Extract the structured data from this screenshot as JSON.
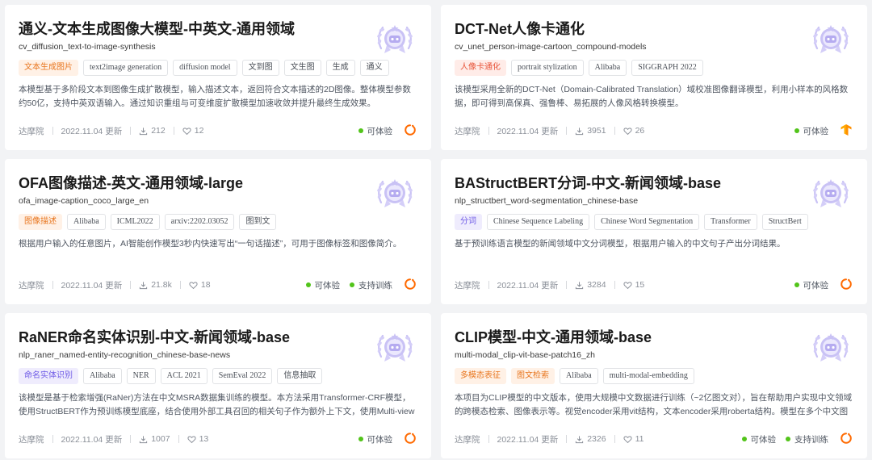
{
  "cards": [
    {
      "title": "通义-文本生成图像大模型-中英文-通用领域",
      "model_id": "cv_diffusion_text-to-image-synthesis",
      "category": "文本生成图片",
      "category_color": "orange",
      "tags": [
        "text2image generation",
        "diffusion model",
        "文到图",
        "文生图",
        "生成",
        "通义"
      ],
      "description": "本模型基于多阶段文本到图像生成扩散模型，输入描述文本，返回符合文本描述的2D图像。整体模型参数约50亿，支持中英双语输入。通过知识重组与可变维度扩散模型加速收敛并提升最终生成效果。",
      "org": "达摩院",
      "updated": "2022.11.04 更新",
      "downloads": "212",
      "likes": "12",
      "statuses": [
        "可体验"
      ],
      "provider_icon": "modelscope-icon"
    },
    {
      "title": "DCT-Net人像卡通化",
      "model_id": "cv_unet_person-image-cartoon_compound-models",
      "category": "人像卡通化",
      "category_color": "red",
      "tags": [
        "portrait stylization",
        "Alibaba",
        "SIGGRAPH 2022"
      ],
      "description": "该模型采用全新的DCT-Net（Domain-Calibrated Translation）域校准图像翻译模型，利用小样本的风格数据，即可得到高保真、强鲁棒、易拓展的人像风格转换模型。",
      "org": "达摩院",
      "updated": "2022.11.04 更新",
      "downloads": "3951",
      "likes": "26",
      "statuses": [
        "可体验"
      ],
      "provider_icon": "tensorflow-icon"
    },
    {
      "title": "OFA图像描述-英文-通用领域-large",
      "model_id": "ofa_image-caption_coco_large_en",
      "category": "图像描述",
      "category_color": "orange",
      "tags": [
        "Alibaba",
        "ICML2022",
        "arxiv:2202.03052",
        "图到文"
      ],
      "description": "根据用户输入的任意图片，AI智能创作模型3秒内快速写出“一句话描述”，可用于图像标签和图像简介。",
      "org": "达摩院",
      "updated": "2022.11.04 更新",
      "downloads": "21.8k",
      "likes": "18",
      "statuses": [
        "可体验",
        "支持训练"
      ],
      "provider_icon": "modelscope-icon"
    },
    {
      "title": "BAStructBERT分词-中文-新闻领域-base",
      "model_id": "nlp_structbert_word-segmentation_chinese-base",
      "category": "分词",
      "category_color": "purple",
      "tags": [
        "Chinese Sequence Labeling",
        "Chinese Word Segmentation",
        "Transformer",
        "StructBert"
      ],
      "description": "基于预训练语言模型的新闻领域中文分词模型，根据用户输入的中文句子产出分词结果。",
      "org": "达摩院",
      "updated": "2022.11.04 更新",
      "downloads": "3284",
      "likes": "15",
      "statuses": [
        "可体验"
      ],
      "provider_icon": "modelscope-icon"
    },
    {
      "title": "RaNER命名实体识别-中文-新闻领域-base",
      "model_id": "nlp_raner_named-entity-recognition_chinese-base-news",
      "category": "命名实体识别",
      "category_color": "purple",
      "tags": [
        "Alibaba",
        "NER",
        "ACL 2021",
        "SemEval 2022",
        "信息抽取"
      ],
      "description": "该模型是基于检索增强(RaNer)方法在中文MSRA数据集训练的模型。本方法采用Transformer-CRF模型，使用StructBERT作为预训练模型底座，结合使用外部工具召回的相关句子作为额外上下文，使用Multi-view Trainin...",
      "org": "达摩院",
      "updated": "2022.11.04 更新",
      "downloads": "1007",
      "likes": "13",
      "statuses": [
        "可体验"
      ],
      "provider_icon": "modelscope-icon"
    },
    {
      "title": "CLIP模型-中文-通用领域-base",
      "model_id": "multi-modal_clip-vit-base-patch16_zh",
      "category": "多模态表征",
      "category_color": "orange",
      "category2": "图文检索",
      "tags": [
        "Alibaba",
        "multi-modal-embedding"
      ],
      "description": "本项目为CLIP模型的中文版本，使用大规模中文数据进行训练（~2亿图文对），旨在帮助用户实现中文领域的跨模态检索、图像表示等。视觉encoder采用vit结构，文本encoder采用roberta结构。模型在多个中文图文检...",
      "org": "达摩院",
      "updated": "2022.11.04 更新",
      "downloads": "2326",
      "likes": "11",
      "statuses": [
        "可体验",
        "支持训练"
      ],
      "provider_icon": "modelscope-icon"
    }
  ],
  "colors": {
    "available_dot": "#52c41a",
    "badge_purple": "#c9c2f5",
    "modelscope_orange": "#ff6a00",
    "tensorflow_orange": "#ff8f00"
  },
  "badge_icon": "laurel-robot-badge-icon",
  "download_icon": "download-icon",
  "like_icon": "heart-icon"
}
